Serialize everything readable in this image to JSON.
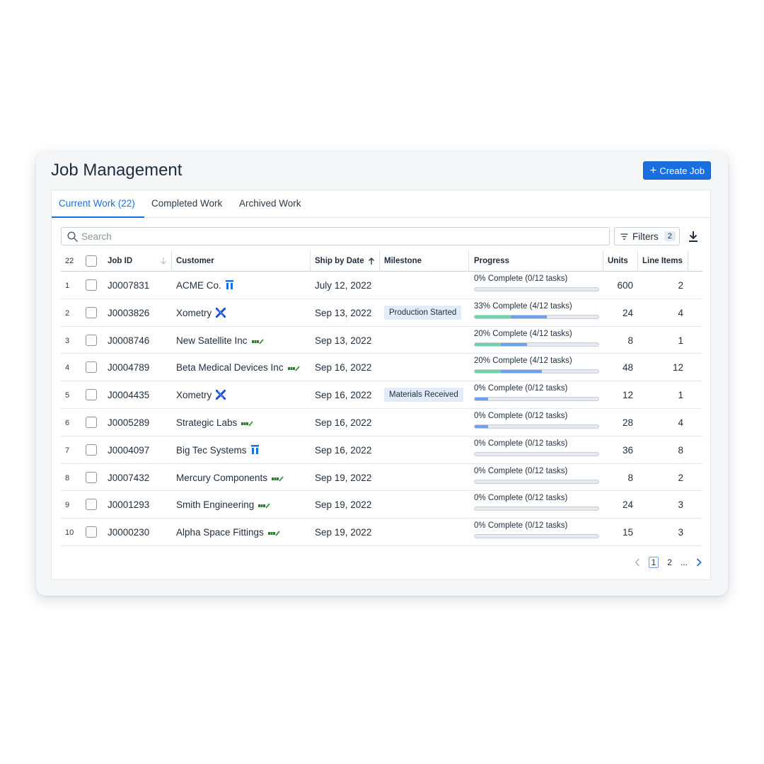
{
  "page": {
    "title": "Job Management",
    "create_button": "Create Job"
  },
  "tabs": [
    {
      "label": "Current Work (22)",
      "active": true
    },
    {
      "label": "Completed Work",
      "active": false
    },
    {
      "label": "Archived Work",
      "active": false
    }
  ],
  "search": {
    "placeholder": "Search",
    "value": ""
  },
  "filters": {
    "label": "Filters",
    "count": "2"
  },
  "table": {
    "total": "22",
    "headers": {
      "job_id": "Job ID",
      "customer": "Customer",
      "ship_by_date": "Ship by Date",
      "milestone": "Milestone",
      "progress": "Progress",
      "units": "Units",
      "line_items": "Line Items"
    },
    "rows": [
      {
        "num": "1",
        "job_id": "J0007831",
        "customer": "ACME Co.",
        "icon": "pillar-icon",
        "ship": "July 12, 2022",
        "milestone": "",
        "progress": "0% Complete (0/12 tasks)",
        "green": 0,
        "blue": 0,
        "units": "600",
        "line_items": "2"
      },
      {
        "num": "2",
        "job_id": "J0003826",
        "customer": "Xometry",
        "icon": "xometry-icon",
        "ship": "Sep 13, 2022",
        "milestone": "Production Started",
        "progress": "33% Complete (4/12 tasks)",
        "green": 29,
        "blue": 29,
        "units": "24",
        "line_items": "4"
      },
      {
        "num": "3",
        "job_id": "J0008746",
        "customer": "New Satellite Inc",
        "icon": "email-icon",
        "ship": "Sep 13, 2022",
        "milestone": "",
        "progress": "20% Complete (4/12 tasks)",
        "green": 21,
        "blue": 21,
        "units": "8",
        "line_items": "1"
      },
      {
        "num": "4",
        "job_id": "J0004789",
        "customer": "Beta Medical Devices Inc",
        "icon": "email-icon",
        "ship": "Sep 16, 2022",
        "milestone": "",
        "progress": "20% Complete (4/12 tasks)",
        "green": 21,
        "blue": 33,
        "units": "48",
        "line_items": "12"
      },
      {
        "num": "5",
        "job_id": "J0004435",
        "customer": "Xometry",
        "icon": "xometry-icon",
        "ship": "Sep 16, 2022",
        "milestone": "Materials Received",
        "progress": "0% Complete (0/12 tasks)",
        "green": 0,
        "blue": 11,
        "units": "12",
        "line_items": "1"
      },
      {
        "num": "6",
        "job_id": "J0005289",
        "customer": "Strategic Labs",
        "icon": "email-icon",
        "ship": "Sep 16, 2022",
        "milestone": "",
        "progress": "0% Complete (0/12 tasks)",
        "green": 0,
        "blue": 11,
        "units": "28",
        "line_items": "4"
      },
      {
        "num": "7",
        "job_id": "J0004097",
        "customer": "Big Tec Systems",
        "icon": "pillar-icon",
        "ship": "Sep 16, 2022",
        "milestone": "",
        "progress": "0% Complete (0/12 tasks)",
        "green": 0,
        "blue": 0,
        "units": "36",
        "line_items": "8"
      },
      {
        "num": "8",
        "job_id": "J0007432",
        "customer": "Mercury Components",
        "icon": "email-icon",
        "ship": "Sep 19, 2022",
        "milestone": "",
        "progress": "0% Complete (0/12 tasks)",
        "green": 0,
        "blue": 0,
        "units": "8",
        "line_items": "2"
      },
      {
        "num": "9",
        "job_id": "J0001293",
        "customer": "Smith Engineering",
        "icon": "email-icon",
        "ship": "Sep 19, 2022",
        "milestone": "",
        "progress": "0% Complete (0/12 tasks)",
        "green": 0,
        "blue": 0,
        "units": "24",
        "line_items": "3"
      },
      {
        "num": "10",
        "job_id": "J0000230",
        "customer": "Alpha Space Fittings",
        "icon": "email-icon",
        "ship": "Sep 19, 2022",
        "milestone": "",
        "progress": "0% Complete (0/12 tasks)",
        "green": 0,
        "blue": 0,
        "units": "15",
        "line_items": "3"
      }
    ]
  },
  "pagination": {
    "pages": [
      "1",
      "2",
      "..."
    ],
    "current": "1"
  },
  "colors": {
    "accent": "#1a6fe0",
    "progress_green": "#6fd3a8",
    "progress_blue": "#6f9ff0",
    "badge_bg": "#e2ecf8"
  }
}
